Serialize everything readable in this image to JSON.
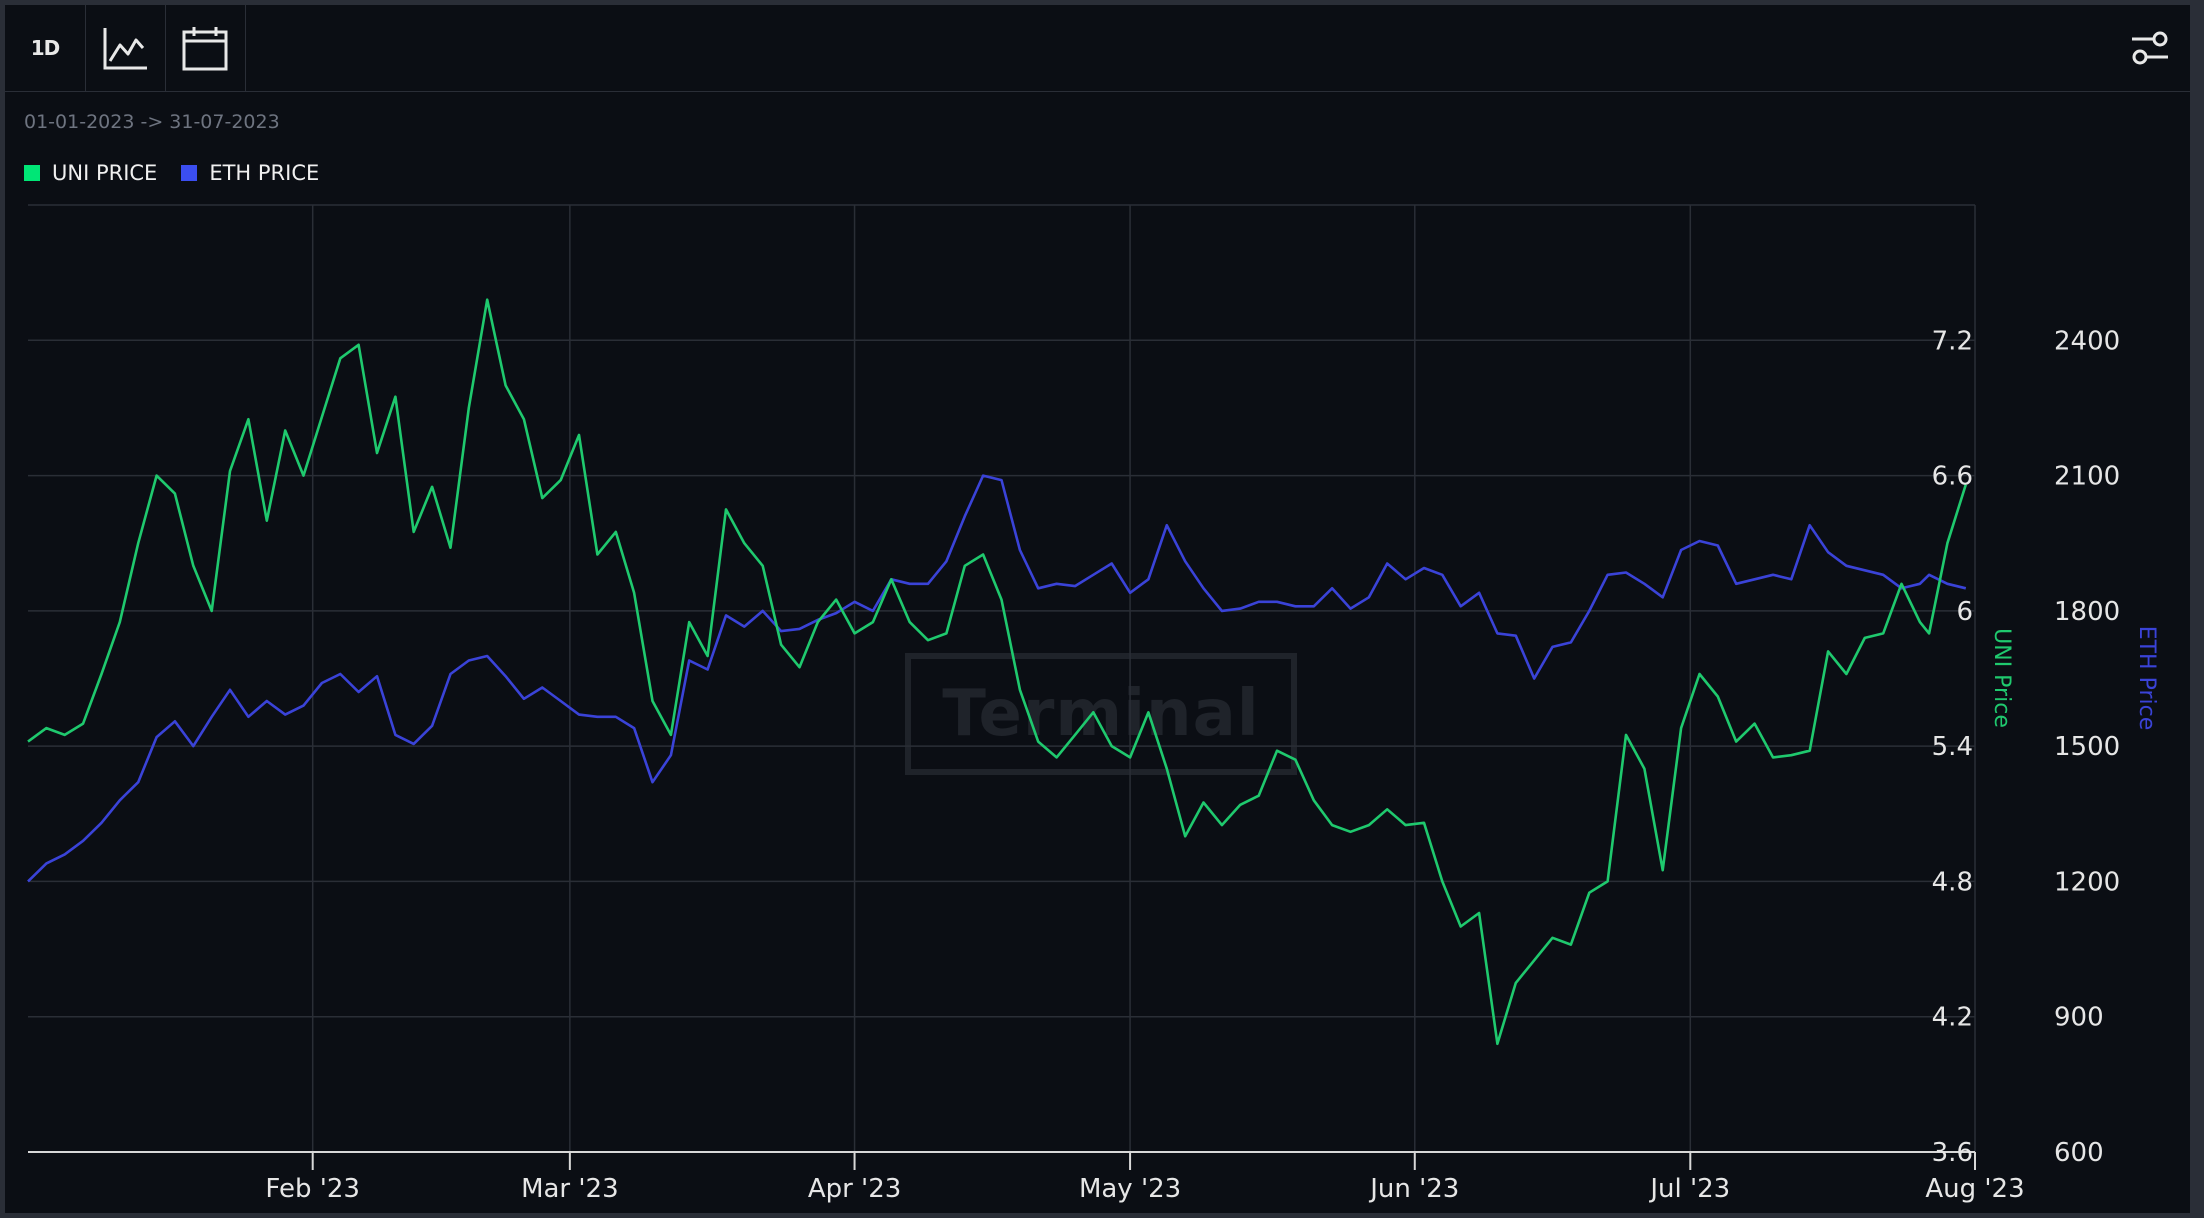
{
  "toolbar": {
    "interval_label": "1D",
    "chart_type_icon": "line-chart-icon",
    "calendar_icon": "calendar-icon",
    "settings_icon": "sliders-icon"
  },
  "date_range": "01-01-2023 -> 31-07-2023",
  "legend": {
    "items": [
      {
        "label": "UNI PRICE",
        "color": "#00e676"
      },
      {
        "label": "ETH PRICE",
        "color": "#3b4ef0"
      }
    ]
  },
  "watermark": "Terminal",
  "colors": {
    "uni": "#1fc96e",
    "eth": "#3a43d8",
    "grid": "#2a2e36",
    "background": "#0b0e14"
  },
  "chart_data": {
    "type": "line",
    "x_ticks": [
      "Feb '23",
      "Mar '23",
      "Apr '23",
      "May '23",
      "Jun '23",
      "Jul '23",
      "Aug '23"
    ],
    "x_range": [
      "2023-01-01",
      "2023-07-31"
    ],
    "grid": true,
    "legend_position": "top-left",
    "y_axes": [
      {
        "label": "UNI Price",
        "ticks": [
          "3.6",
          "4.2",
          "4.8",
          "5.4",
          "6",
          "6.6",
          "7.2"
        ],
        "range": [
          3.6,
          7.8
        ]
      },
      {
        "label": "ETH Price",
        "ticks": [
          "600",
          "900",
          "1200",
          "1500",
          "1800",
          "2100",
          "2400"
        ],
        "range": [
          600,
          2700
        ]
      }
    ],
    "series": [
      {
        "name": "UNI PRICE",
        "axis": 0,
        "points": [
          [
            "2023-01-01",
            5.42
          ],
          [
            "2023-01-03",
            5.48
          ],
          [
            "2023-01-05",
            5.45
          ],
          [
            "2023-01-07",
            5.5
          ],
          [
            "2023-01-09",
            5.72
          ],
          [
            "2023-01-11",
            5.95
          ],
          [
            "2023-01-13",
            6.3
          ],
          [
            "2023-01-15",
            6.6
          ],
          [
            "2023-01-17",
            6.52
          ],
          [
            "2023-01-19",
            6.2
          ],
          [
            "2023-01-21",
            6.0
          ],
          [
            "2023-01-23",
            6.62
          ],
          [
            "2023-01-25",
            6.85
          ],
          [
            "2023-01-27",
            6.4
          ],
          [
            "2023-01-29",
            6.8
          ],
          [
            "2023-01-31",
            6.6
          ],
          [
            "2023-02-02",
            6.86
          ],
          [
            "2023-02-04",
            7.12
          ],
          [
            "2023-02-06",
            7.18
          ],
          [
            "2023-02-08",
            6.7
          ],
          [
            "2023-02-10",
            6.95
          ],
          [
            "2023-02-12",
            6.35
          ],
          [
            "2023-02-14",
            6.55
          ],
          [
            "2023-02-16",
            6.28
          ],
          [
            "2023-02-18",
            6.9
          ],
          [
            "2023-02-20",
            7.38
          ],
          [
            "2023-02-22",
            7.0
          ],
          [
            "2023-02-24",
            6.85
          ],
          [
            "2023-02-26",
            6.5
          ],
          [
            "2023-02-28",
            6.58
          ],
          [
            "2023-03-02",
            6.78
          ],
          [
            "2023-03-04",
            6.25
          ],
          [
            "2023-03-06",
            6.35
          ],
          [
            "2023-03-08",
            6.08
          ],
          [
            "2023-03-10",
            5.6
          ],
          [
            "2023-03-12",
            5.45
          ],
          [
            "2023-03-14",
            5.95
          ],
          [
            "2023-03-16",
            5.8
          ],
          [
            "2023-03-18",
            6.45
          ],
          [
            "2023-03-20",
            6.3
          ],
          [
            "2023-03-22",
            6.2
          ],
          [
            "2023-03-24",
            5.85
          ],
          [
            "2023-03-26",
            5.75
          ],
          [
            "2023-03-28",
            5.95
          ],
          [
            "2023-03-30",
            6.05
          ],
          [
            "2023-04-01",
            5.9
          ],
          [
            "2023-04-03",
            5.95
          ],
          [
            "2023-04-05",
            6.14
          ],
          [
            "2023-04-07",
            5.95
          ],
          [
            "2023-04-09",
            5.87
          ],
          [
            "2023-04-11",
            5.9
          ],
          [
            "2023-04-13",
            6.2
          ],
          [
            "2023-04-15",
            6.25
          ],
          [
            "2023-04-17",
            6.05
          ],
          [
            "2023-04-19",
            5.65
          ],
          [
            "2023-04-21",
            5.42
          ],
          [
            "2023-04-23",
            5.35
          ],
          [
            "2023-04-25",
            5.45
          ],
          [
            "2023-04-27",
            5.55
          ],
          [
            "2023-04-29",
            5.4
          ],
          [
            "2023-05-01",
            5.35
          ],
          [
            "2023-05-03",
            5.55
          ],
          [
            "2023-05-05",
            5.3
          ],
          [
            "2023-05-07",
            5.0
          ],
          [
            "2023-05-09",
            5.15
          ],
          [
            "2023-05-11",
            5.05
          ],
          [
            "2023-05-13",
            5.14
          ],
          [
            "2023-05-15",
            5.18
          ],
          [
            "2023-05-17",
            5.38
          ],
          [
            "2023-05-19",
            5.34
          ],
          [
            "2023-05-21",
            5.16
          ],
          [
            "2023-05-23",
            5.05
          ],
          [
            "2023-05-25",
            5.02
          ],
          [
            "2023-05-27",
            5.05
          ],
          [
            "2023-05-29",
            5.12
          ],
          [
            "2023-05-31",
            5.05
          ],
          [
            "2023-06-02",
            5.06
          ],
          [
            "2023-06-04",
            4.8
          ],
          [
            "2023-06-06",
            4.6
          ],
          [
            "2023-06-08",
            4.66
          ],
          [
            "2023-06-10",
            4.08
          ],
          [
            "2023-06-12",
            4.35
          ],
          [
            "2023-06-14",
            4.45
          ],
          [
            "2023-06-16",
            4.55
          ],
          [
            "2023-06-18",
            4.52
          ],
          [
            "2023-06-20",
            4.75
          ],
          [
            "2023-06-22",
            4.8
          ],
          [
            "2023-06-24",
            5.45
          ],
          [
            "2023-06-26",
            5.3
          ],
          [
            "2023-06-28",
            4.85
          ],
          [
            "2023-06-30",
            5.48
          ],
          [
            "2023-07-02",
            5.72
          ],
          [
            "2023-07-04",
            5.62
          ],
          [
            "2023-07-06",
            5.42
          ],
          [
            "2023-07-08",
            5.5
          ],
          [
            "2023-07-10",
            5.35
          ],
          [
            "2023-07-12",
            5.36
          ],
          [
            "2023-07-14",
            5.38
          ],
          [
            "2023-07-16",
            5.82
          ],
          [
            "2023-07-18",
            5.72
          ],
          [
            "2023-07-20",
            5.88
          ],
          [
            "2023-07-22",
            5.9
          ],
          [
            "2023-07-24",
            6.12
          ],
          [
            "2023-07-26",
            5.95
          ],
          [
            "2023-07-27",
            5.9
          ],
          [
            "2023-07-29",
            6.3
          ],
          [
            "2023-07-31",
            6.56
          ]
        ]
      },
      {
        "name": "ETH PRICE",
        "axis": 1,
        "points": [
          [
            "2023-01-01",
            1200
          ],
          [
            "2023-01-03",
            1240
          ],
          [
            "2023-01-05",
            1260
          ],
          [
            "2023-01-07",
            1290
          ],
          [
            "2023-01-09",
            1330
          ],
          [
            "2023-01-11",
            1380
          ],
          [
            "2023-01-13",
            1420
          ],
          [
            "2023-01-15",
            1520
          ],
          [
            "2023-01-17",
            1555
          ],
          [
            "2023-01-19",
            1500
          ],
          [
            "2023-01-21",
            1565
          ],
          [
            "2023-01-23",
            1625
          ],
          [
            "2023-01-25",
            1565
          ],
          [
            "2023-01-27",
            1600
          ],
          [
            "2023-01-29",
            1570
          ],
          [
            "2023-01-31",
            1590
          ],
          [
            "2023-02-02",
            1640
          ],
          [
            "2023-02-04",
            1660
          ],
          [
            "2023-02-06",
            1620
          ],
          [
            "2023-02-08",
            1655
          ],
          [
            "2023-02-10",
            1525
          ],
          [
            "2023-02-12",
            1505
          ],
          [
            "2023-02-14",
            1545
          ],
          [
            "2023-02-16",
            1660
          ],
          [
            "2023-02-18",
            1690
          ],
          [
            "2023-02-20",
            1700
          ],
          [
            "2023-02-22",
            1655
          ],
          [
            "2023-02-24",
            1605
          ],
          [
            "2023-02-26",
            1630
          ],
          [
            "2023-02-28",
            1600
          ],
          [
            "2023-03-02",
            1570
          ],
          [
            "2023-03-04",
            1565
          ],
          [
            "2023-03-06",
            1565
          ],
          [
            "2023-03-08",
            1540
          ],
          [
            "2023-03-10",
            1420
          ],
          [
            "2023-03-12",
            1480
          ],
          [
            "2023-03-14",
            1690
          ],
          [
            "2023-03-16",
            1670
          ],
          [
            "2023-03-18",
            1790
          ],
          [
            "2023-03-20",
            1765
          ],
          [
            "2023-03-22",
            1800
          ],
          [
            "2023-03-24",
            1755
          ],
          [
            "2023-03-26",
            1760
          ],
          [
            "2023-03-28",
            1780
          ],
          [
            "2023-03-30",
            1795
          ],
          [
            "2023-04-01",
            1820
          ],
          [
            "2023-04-03",
            1800
          ],
          [
            "2023-04-05",
            1870
          ],
          [
            "2023-04-07",
            1860
          ],
          [
            "2023-04-09",
            1860
          ],
          [
            "2023-04-11",
            1910
          ],
          [
            "2023-04-13",
            2010
          ],
          [
            "2023-04-15",
            2100
          ],
          [
            "2023-04-17",
            2090
          ],
          [
            "2023-04-19",
            1935
          ],
          [
            "2023-04-21",
            1850
          ],
          [
            "2023-04-23",
            1860
          ],
          [
            "2023-04-25",
            1855
          ],
          [
            "2023-04-27",
            1880
          ],
          [
            "2023-04-29",
            1905
          ],
          [
            "2023-05-01",
            1840
          ],
          [
            "2023-05-03",
            1870
          ],
          [
            "2023-05-05",
            1990
          ],
          [
            "2023-05-07",
            1910
          ],
          [
            "2023-05-09",
            1850
          ],
          [
            "2023-05-11",
            1800
          ],
          [
            "2023-05-13",
            1805
          ],
          [
            "2023-05-15",
            1820
          ],
          [
            "2023-05-17",
            1820
          ],
          [
            "2023-05-19",
            1810
          ],
          [
            "2023-05-21",
            1810
          ],
          [
            "2023-05-23",
            1850
          ],
          [
            "2023-05-25",
            1805
          ],
          [
            "2023-05-27",
            1830
          ],
          [
            "2023-05-29",
            1905
          ],
          [
            "2023-05-31",
            1870
          ],
          [
            "2023-06-02",
            1895
          ],
          [
            "2023-06-04",
            1880
          ],
          [
            "2023-06-06",
            1810
          ],
          [
            "2023-06-08",
            1840
          ],
          [
            "2023-06-10",
            1750
          ],
          [
            "2023-06-12",
            1745
          ],
          [
            "2023-06-14",
            1650
          ],
          [
            "2023-06-16",
            1720
          ],
          [
            "2023-06-18",
            1730
          ],
          [
            "2023-06-20",
            1800
          ],
          [
            "2023-06-22",
            1880
          ],
          [
            "2023-06-24",
            1885
          ],
          [
            "2023-06-26",
            1860
          ],
          [
            "2023-06-28",
            1830
          ],
          [
            "2023-06-30",
            1935
          ],
          [
            "2023-07-02",
            1955
          ],
          [
            "2023-07-04",
            1945
          ],
          [
            "2023-07-06",
            1860
          ],
          [
            "2023-07-08",
            1870
          ],
          [
            "2023-07-10",
            1880
          ],
          [
            "2023-07-12",
            1870
          ],
          [
            "2023-07-14",
            1990
          ],
          [
            "2023-07-16",
            1930
          ],
          [
            "2023-07-18",
            1900
          ],
          [
            "2023-07-20",
            1890
          ],
          [
            "2023-07-22",
            1880
          ],
          [
            "2023-07-24",
            1850
          ],
          [
            "2023-07-26",
            1860
          ],
          [
            "2023-07-27",
            1880
          ],
          [
            "2023-07-29",
            1860
          ],
          [
            "2023-07-31",
            1850
          ]
        ]
      }
    ]
  }
}
